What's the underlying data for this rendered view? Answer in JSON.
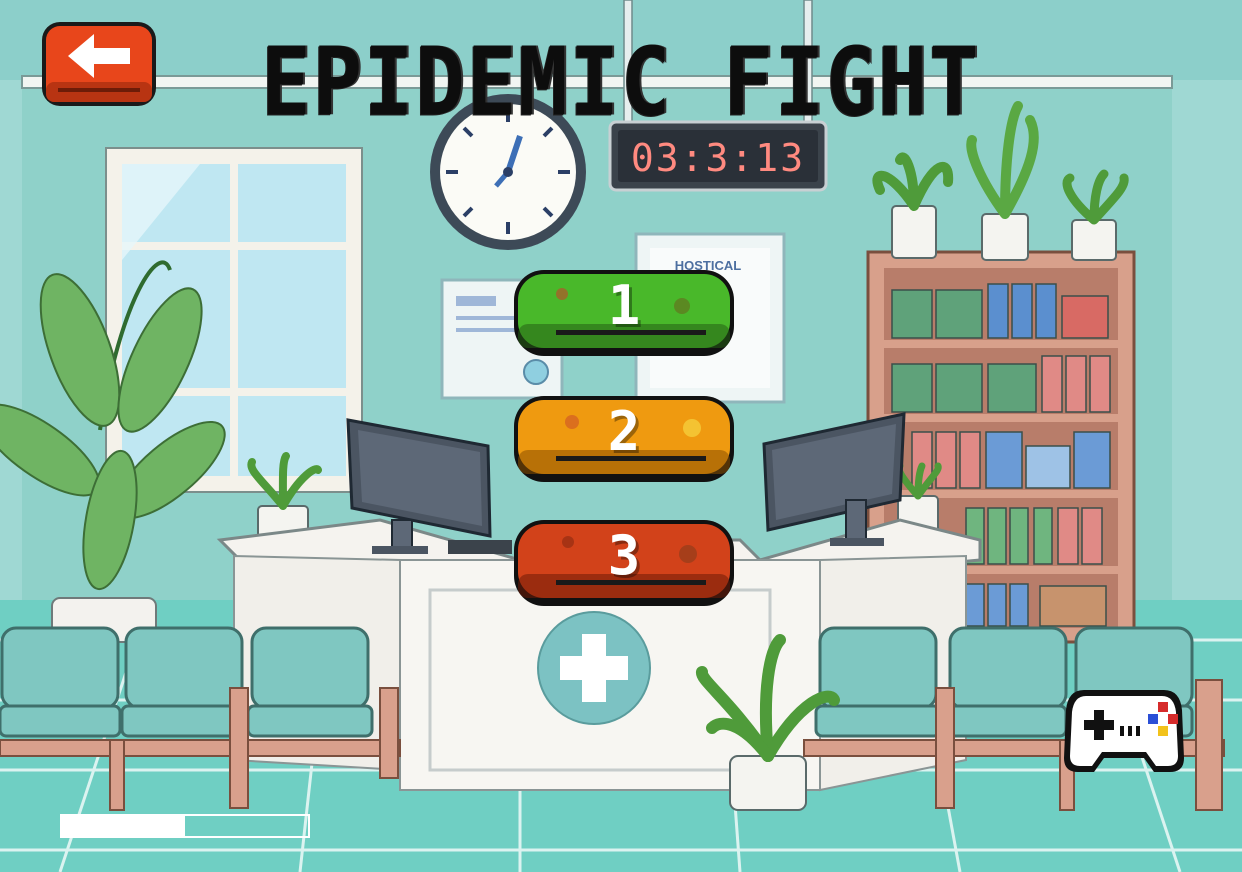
{
  "game": {
    "title": "EPIDEMIC FIGHT",
    "clock_display": "03:3:13",
    "poster_text": "HOSTICAL"
  },
  "level_select": {
    "levels": [
      {
        "label": "1",
        "color": "#49b82a",
        "edge": "#245f14"
      },
      {
        "label": "2",
        "color": "#ef9a10",
        "edge": "#8a5000"
      },
      {
        "label": "3",
        "color": "#d2421a",
        "edge": "#6d1c08"
      }
    ]
  },
  "progress": {
    "value": 0.5
  },
  "icons": {
    "back": "back-arrow-icon",
    "controller": "gamepad-icon"
  },
  "colors": {
    "accent_red": "#e8461b",
    "wall": "#8fd1c9",
    "floor": "#6fcfc3"
  }
}
